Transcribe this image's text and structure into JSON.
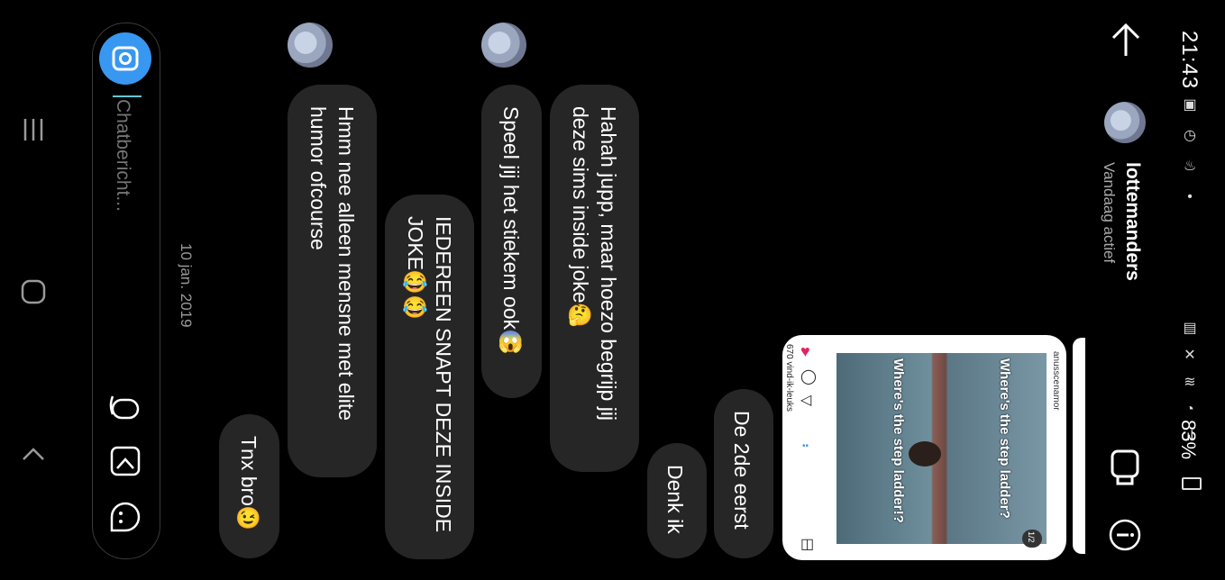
{
  "status_bar": {
    "time": "21:43",
    "battery": "83%"
  },
  "header": {
    "username": "lottemanders",
    "status": "Vandaag actief"
  },
  "shared_post": {
    "page_indicator": "1/2",
    "account": "anusscenamor",
    "caption_top": "Where's the step ladder?",
    "caption_bottom": "Where's the step ladder!?",
    "likes": "670 vind-ik-leuks"
  },
  "messages": [
    {
      "id": "m1",
      "side": "sent",
      "text": "De 2de eerst"
    },
    {
      "id": "m2",
      "side": "sent",
      "text": "Denk ik"
    },
    {
      "id": "m3",
      "side": "received",
      "text": "Hahah jupp, maar hoezo begrijp jij deze sims inside joke🤔"
    },
    {
      "id": "m4",
      "side": "received",
      "text": "Speel jij het stiekem ook😱"
    },
    {
      "id": "m5",
      "side": "sent",
      "text": "IEDEREEN SNAPT DEZE INSIDE JOKE😂😂"
    },
    {
      "id": "m6",
      "side": "received",
      "text": "Hmm nee alleen mensne met elite humor ofcourse"
    },
    {
      "id": "m7",
      "side": "sent",
      "text": "Tnx bro😉"
    }
  ],
  "date_separator": "10 jan. 2019",
  "composer": {
    "placeholder": "Chatbericht..."
  },
  "icons": {
    "back": "arrow-left-icon",
    "video": "video-call-icon",
    "info": "info-icon",
    "camera": "camera-icon",
    "mic": "microphone-icon",
    "gallery": "gallery-icon",
    "sticker": "sticker-icon"
  }
}
